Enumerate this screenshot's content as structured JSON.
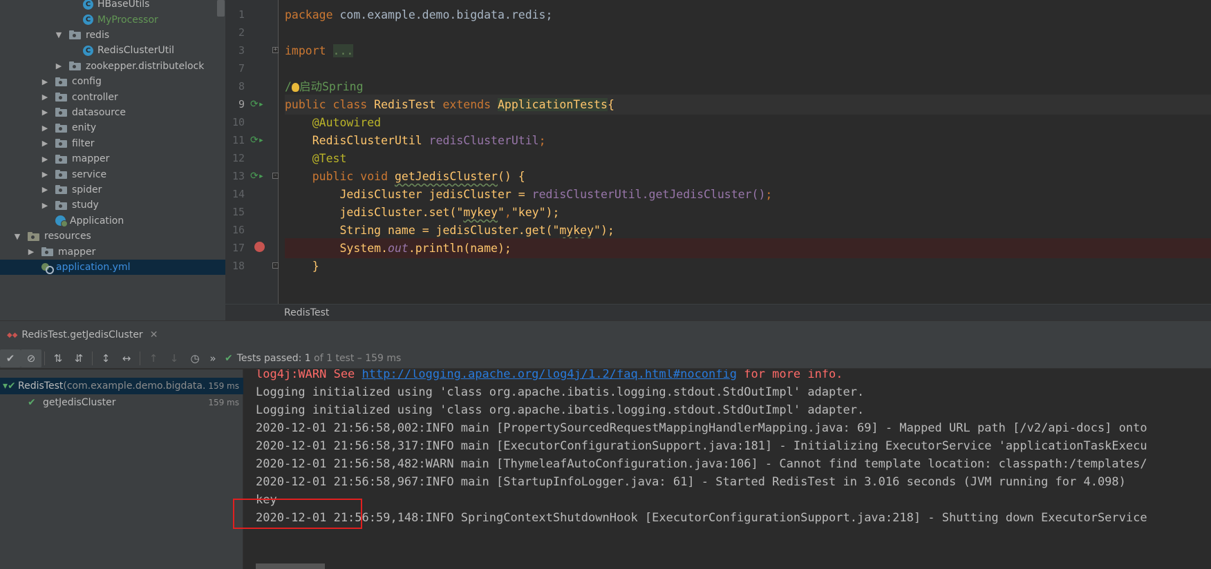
{
  "project_tree": {
    "items": [
      {
        "label": "HBaseUtils",
        "kind": "class",
        "arrow": "none",
        "depth": 5,
        "color": "default"
      },
      {
        "label": "MyProcessor",
        "kind": "class",
        "arrow": "none",
        "depth": 5,
        "color": "green"
      },
      {
        "label": "redis",
        "kind": "folder",
        "arrow": "down",
        "depth": 4,
        "color": "default"
      },
      {
        "label": "RedisClusterUtil",
        "kind": "class",
        "arrow": "none",
        "depth": 5,
        "color": "default"
      },
      {
        "label": "zookepper.distributelock",
        "kind": "folder",
        "arrow": "right",
        "depth": 4,
        "color": "default"
      },
      {
        "label": "config",
        "kind": "folder",
        "arrow": "right",
        "depth": 3,
        "color": "default"
      },
      {
        "label": "controller",
        "kind": "folder",
        "arrow": "right",
        "depth": 3,
        "color": "default"
      },
      {
        "label": "datasource",
        "kind": "folder",
        "arrow": "right",
        "depth": 3,
        "color": "default"
      },
      {
        "label": "enity",
        "kind": "folder",
        "arrow": "right",
        "depth": 3,
        "color": "default"
      },
      {
        "label": "filter",
        "kind": "folder",
        "arrow": "right",
        "depth": 3,
        "color": "default"
      },
      {
        "label": "mapper",
        "kind": "folder",
        "arrow": "right",
        "depth": 3,
        "color": "default"
      },
      {
        "label": "service",
        "kind": "folder",
        "arrow": "right",
        "depth": 3,
        "color": "default"
      },
      {
        "label": "spider",
        "kind": "folder",
        "arrow": "right",
        "depth": 3,
        "color": "default"
      },
      {
        "label": "study",
        "kind": "folder",
        "arrow": "right",
        "depth": 3,
        "color": "default"
      },
      {
        "label": "Application",
        "kind": "app",
        "arrow": "none",
        "depth": 3,
        "color": "default"
      },
      {
        "label": "resources",
        "kind": "resfolder",
        "arrow": "down",
        "depth": 1,
        "color": "default"
      },
      {
        "label": "mapper",
        "kind": "folder",
        "arrow": "right",
        "depth": 2,
        "color": "default"
      },
      {
        "label": "application.yml",
        "kind": "yml",
        "arrow": "none",
        "depth": 2,
        "color": "blue",
        "selected": true
      }
    ]
  },
  "editor": {
    "line_numbers": [
      "1",
      "2",
      "3",
      "7",
      "8",
      "9",
      "10",
      "11",
      "12",
      "13",
      "14",
      "15",
      "16",
      "17",
      "18"
    ],
    "current_line": "9",
    "breakpoint_line": "17",
    "breadcrumb": "RedisTest",
    "code": {
      "l1_kw": "package",
      "l1_rest": " com.example.demo.bigdata.redis;",
      "l3_kw": "import",
      "l3_fold": "...",
      "l8_slash": "/",
      "l8_comment": "启动Spring",
      "l9_kw1": "public",
      "l9_kw2": "class",
      "l9_name": "RedisTest",
      "l9_kw3": "extends",
      "l9_parent": "ApplicationTests",
      "l9_brace": "{",
      "l10_ann": "@Autowired",
      "l11_type": "RedisClusterUtil",
      "l11_field": "redisClusterUtil",
      "l11_semi": ";",
      "l12_ann": "@Test",
      "l13_kw1": "public",
      "l13_kw2": "void",
      "l13_fn": "getJedisCluster",
      "l13_rest": "() {",
      "l14_type": "JedisCluster jedisCluster = ",
      "l14_field": "redisClusterUtil",
      "l14_call": ".getJedisCluster()",
      "l14_semi": ";",
      "l15_obj": "jedisCluster.set(",
      "l15_s1a": "\"",
      "l15_s1b": "mykey",
      "l15_s1c": "\"",
      "l15_comma": ",",
      "l15_s2": "\"key\"",
      "l15_end": ");",
      "l16_a": "String name = jedisCluster.get(",
      "l16_s1a": "\"",
      "l16_s1b": "mykey",
      "l16_s1c": "\"",
      "l16_end": ");",
      "l17_a": "System.",
      "l17_out": "out",
      "l17_b": ".println(name);",
      "l18": "}"
    }
  },
  "run_panel": {
    "tab_label": "RedisTest.getJedisCluster",
    "status": {
      "prefix": "Tests passed:",
      "count": "1",
      "suffix": "of 1 test – 159 ms"
    },
    "test_tree": [
      {
        "name": "RedisTest",
        "pkg": " (com.example.demo.bigdata.r",
        "time": "159 ms"
      },
      {
        "name": "getJedisCluster",
        "pkg": "",
        "time": "159 ms"
      }
    ],
    "console_lines": [
      {
        "red1": "log4j:WARN See ",
        "link": "http://logging.apache.org/log4j/1.2/faq.html#noconfig",
        "red2": " for more info."
      },
      {
        "text": "Logging initialized using 'class org.apache.ibatis.logging.stdout.StdOutImpl' adapter."
      },
      {
        "text": "Logging initialized using 'class org.apache.ibatis.logging.stdout.StdOutImpl' adapter."
      },
      {
        "text": "2020-12-01 21:56:58,002:INFO main [PropertySourcedRequestMappingHandlerMapping.java: 69] - Mapped URL path [/v2/api-docs] onto"
      },
      {
        "text": "2020-12-01 21:56:58,317:INFO main [ExecutorConfigurationSupport.java:181] - Initializing ExecutorService 'applicationTaskExecu"
      },
      {
        "text": "2020-12-01 21:56:58,482:WARN main [ThymeleafAutoConfiguration.java:106] - Cannot find template location: classpath:/templates/"
      },
      {
        "text": "2020-12-01 21:56:58,967:INFO main [StartupInfoLogger.java: 61] - Started RedisTest in 3.016 seconds (JVM running for 4.098)"
      },
      {
        "text": "key"
      },
      {
        "text": "2020-12-01 21:56:59,148:INFO SpringContextShutdownHook [ExecutorConfigurationSupport.java:218] - Shutting down ExecutorService"
      }
    ]
  },
  "colors": {
    "keyword": "#cc7832",
    "annotation": "#bbb529",
    "field": "#9876aa",
    "string": "#6a8759",
    "method": "#ffc66d",
    "pass": "#59a869",
    "error": "#ff6b68",
    "highlight_box": "#e02020"
  }
}
